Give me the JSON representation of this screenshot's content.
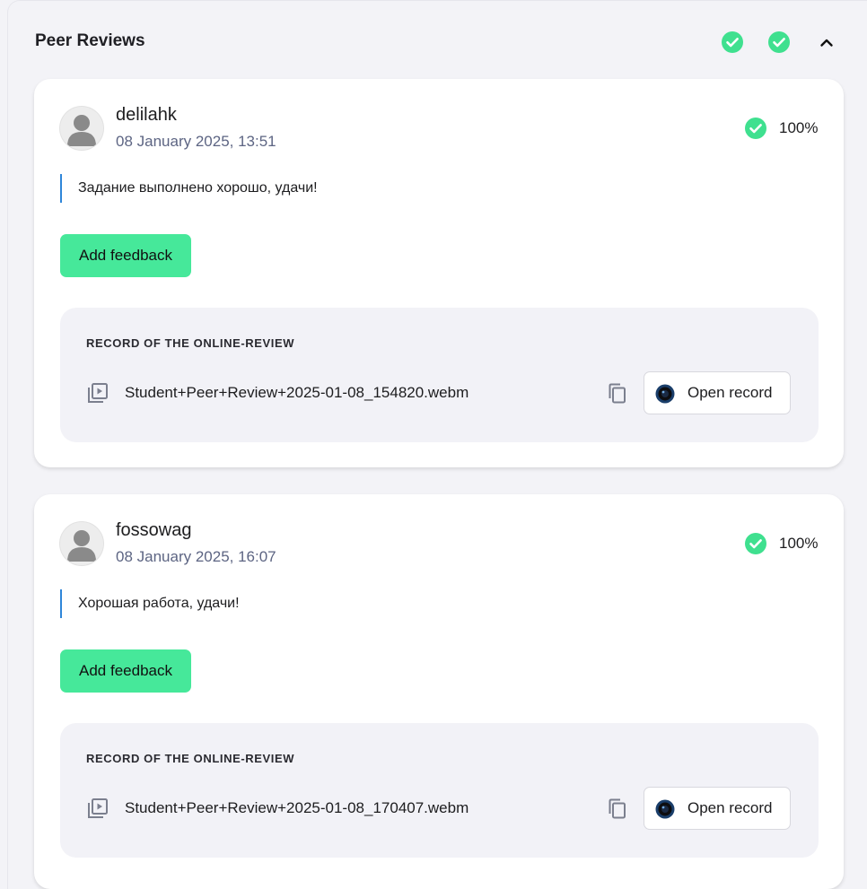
{
  "panel": {
    "title": "Peer Reviews",
    "status_icons": [
      "check-circle-icon",
      "check-circle-icon"
    ],
    "collapse_icon": "chevron-up-icon"
  },
  "colors": {
    "accent_green": "#46e89a",
    "check_green": "#3fe08f",
    "quote_border": "#2f86d9",
    "date_text": "#5d6583"
  },
  "reviews": [
    {
      "username": "delilahk",
      "date": "08 January 2025, 13:51",
      "score": "100%",
      "comment": "Задание выполнено хорошо, удачи!",
      "add_feedback_label": "Add feedback",
      "record": {
        "title": "RECORD OF THE ONLINE-REVIEW",
        "filename": "Student+Peer+Review+2025-01-08_154820.webm",
        "open_label": "Open record"
      }
    },
    {
      "username": "fossowag",
      "date": "08 January 2025, 16:07",
      "score": "100%",
      "comment": "Хорошая работа, удачи!",
      "add_feedback_label": "Add feedback",
      "record": {
        "title": "RECORD OF THE ONLINE-REVIEW",
        "filename": "Student+Peer+Review+2025-01-08_170407.webm",
        "open_label": "Open record"
      }
    }
  ]
}
